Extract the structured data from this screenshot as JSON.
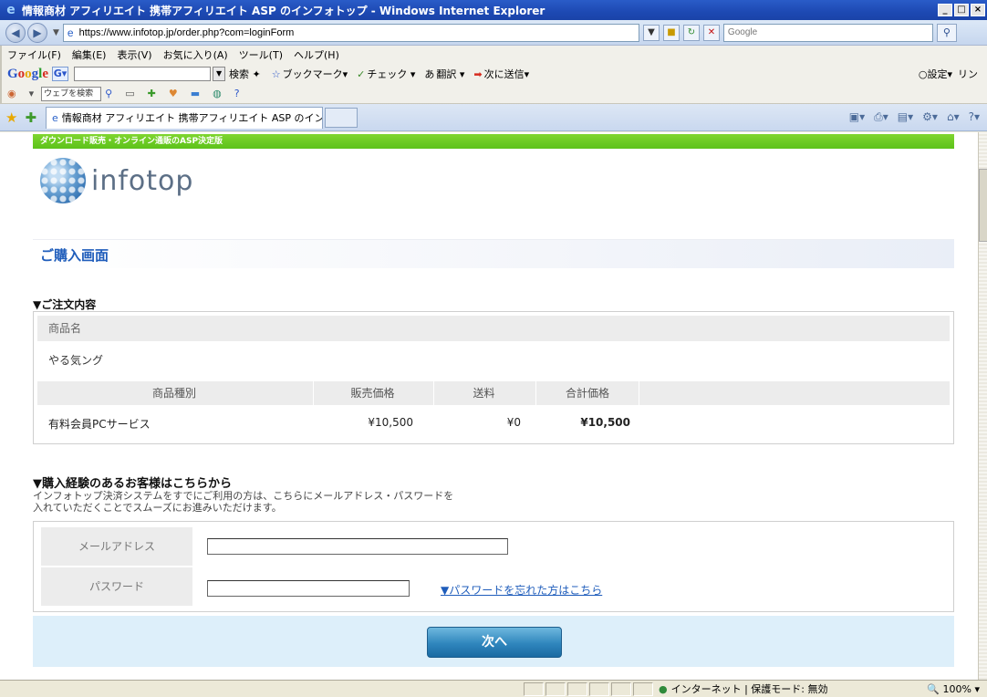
{
  "window": {
    "title": "情報商材 アフィリエイト 携帯アフィリエイト ASP のインフォトップ - Windows Internet Explorer",
    "buttons": [
      "_",
      "□",
      "×"
    ]
  },
  "address_bar": {
    "url": "https://www.infotop.jp/order.php?com=loginForm",
    "search_placeholder": "Google"
  },
  "menu": [
    "ファイル(F)",
    "編集(E)",
    "表示(V)",
    "お気に入り(A)",
    "ツール(T)",
    "ヘルプ(H)"
  ],
  "google_toolbar": {
    "search_label": "検索",
    "bookmarks": "ブックマーク▾",
    "check": "チェック ▾",
    "translate": "翻訳 ▾",
    "send": "次に送信▾",
    "settings": "設定▾",
    "links": "リン"
  },
  "toolbar2": {
    "web_search": "ウェブを検索"
  },
  "tab": {
    "label": "情報商材 アフィリエイト 携帯アフィリエイト ASP のインフ..."
  },
  "page": {
    "banner": "ダウンロード販売・オンライン通販のASP決定版",
    "logo_text": "infotop",
    "title": "ご購入画面",
    "order_section": {
      "heading": "▼ご注文内容",
      "product_label": "商品名",
      "product_name": "やる気ング",
      "columns": [
        "商品種別",
        "販売価格",
        "送料",
        "合計価格"
      ],
      "row": {
        "type": "有料会員PCサービス",
        "price": "¥10,500",
        "shipping": "¥0",
        "total": "¥10,500"
      }
    },
    "login_section": {
      "heading": "▼購入経験のあるお客様はこちらから",
      "desc_line1": "インフォトップ決済システムをすでにご利用の方は、こちらにメールアドレス・パスワードを",
      "desc_line2": "入れていただくことでスムーズにお進みいただけます。",
      "email_label": "メールアドレス",
      "password_label": "パスワード",
      "email_value": "",
      "password_value": "",
      "forgot_link": "▼パスワードを忘れた方はこちら",
      "next_button": "次へ"
    }
  },
  "status_bar": {
    "zone": "インターネット | 保護モード: 無効",
    "zoom": "100%"
  }
}
